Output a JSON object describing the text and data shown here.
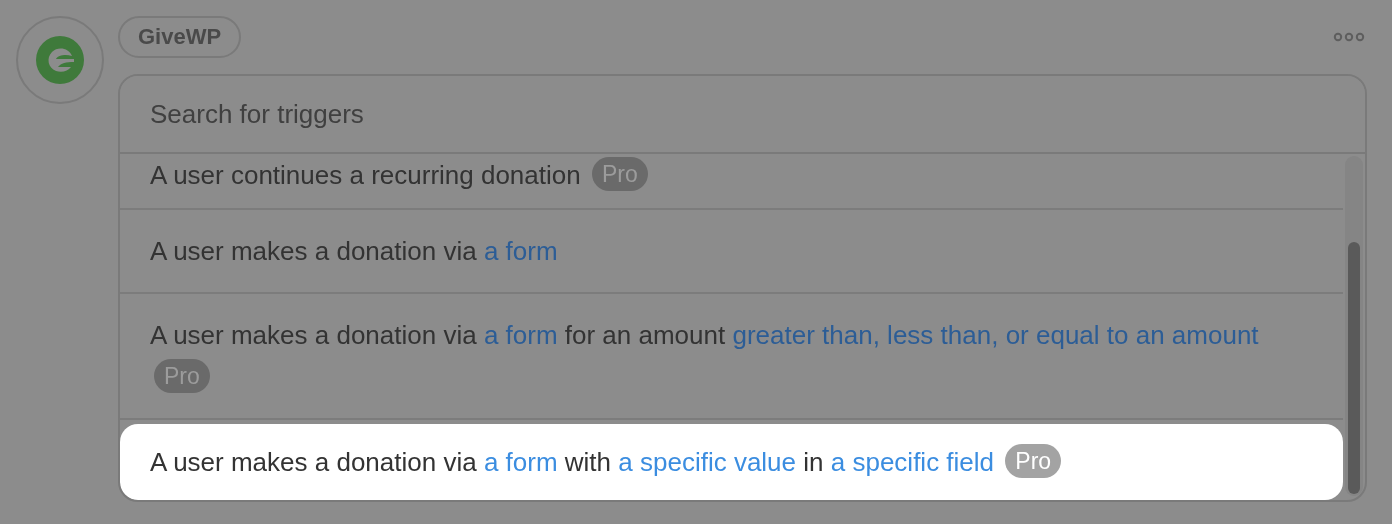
{
  "app": {
    "name": "GiveWP"
  },
  "search": {
    "placeholder": "Search for triggers"
  },
  "triggers": [
    {
      "parts": [
        {
          "kind": "plain",
          "text": "A user continues a recurring donation"
        }
      ],
      "badge": "Pro",
      "selected": false
    },
    {
      "parts": [
        {
          "kind": "plain",
          "text": "A user makes a donation via"
        },
        {
          "kind": "link",
          "text": "a form"
        }
      ],
      "selected": false
    },
    {
      "parts": [
        {
          "kind": "plain",
          "text": "A user makes a donation via"
        },
        {
          "kind": "link",
          "text": "a form"
        },
        {
          "kind": "plain",
          "text": "for an amount"
        },
        {
          "kind": "link",
          "text": "greater than, less than, or equal to an amount"
        }
      ],
      "badge": "Pro",
      "selected": false
    },
    {
      "parts": [
        {
          "kind": "plain",
          "text": "A user makes a donation via"
        },
        {
          "kind": "link",
          "text": "a form"
        },
        {
          "kind": "plain",
          "text": "with"
        },
        {
          "kind": "link",
          "text": "a specific value"
        },
        {
          "kind": "plain",
          "text": "in"
        },
        {
          "kind": "link",
          "text": "a specific field"
        }
      ],
      "badge": "Pro",
      "selected": true
    }
  ]
}
